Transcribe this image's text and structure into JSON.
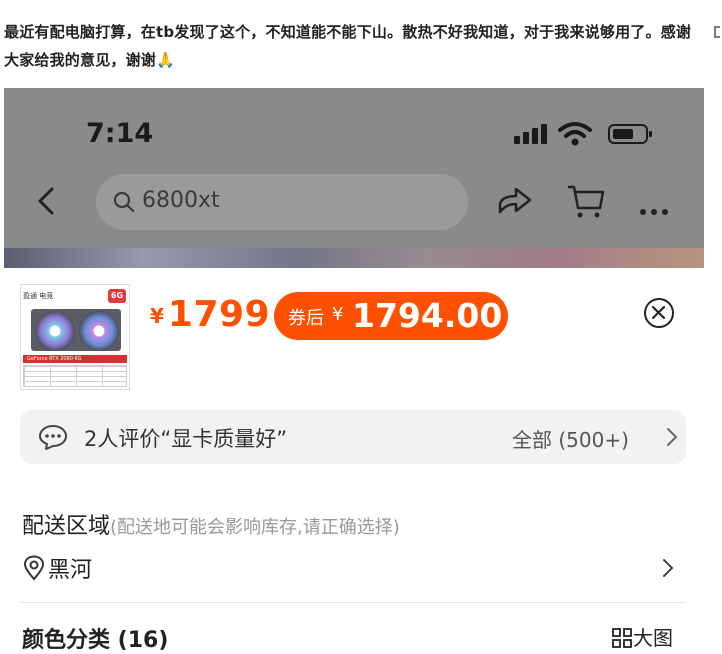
{
  "post": {
    "text": "最近有配电脑打算，在tb发现了这个，不知道能不能下山。散热不好我知道，对于我来说够用了。感谢大家给我的意见，谢谢🙏"
  },
  "status_bar": {
    "time": "7:14"
  },
  "nav": {
    "search_text": "6800xt",
    "icons": [
      "back-icon",
      "search-icon",
      "share-icon",
      "cart-icon",
      "more-icon"
    ]
  },
  "product": {
    "thumb_tag": "6G",
    "thumb_brand": "盈通 电竞",
    "thumb_banner": "GeForce RTX 2060 6G",
    "price_symbol": "¥",
    "price": "1799",
    "coupon_label": "券后",
    "coupon_symbol": "¥",
    "coupon_price": "1794.00"
  },
  "reviews": {
    "summary": "2人评价“显卡质量好”",
    "all_label": "全部 (500+)"
  },
  "delivery": {
    "title": "配送区域",
    "hint": "(配送地可能会影响库存,请正确选择)",
    "location": "黑河"
  },
  "color": {
    "title": "颜色分类 (16)",
    "big_image_label": "大图"
  },
  "colors": {
    "accent": "#ff5000",
    "overlay": "#8a8a8a"
  }
}
